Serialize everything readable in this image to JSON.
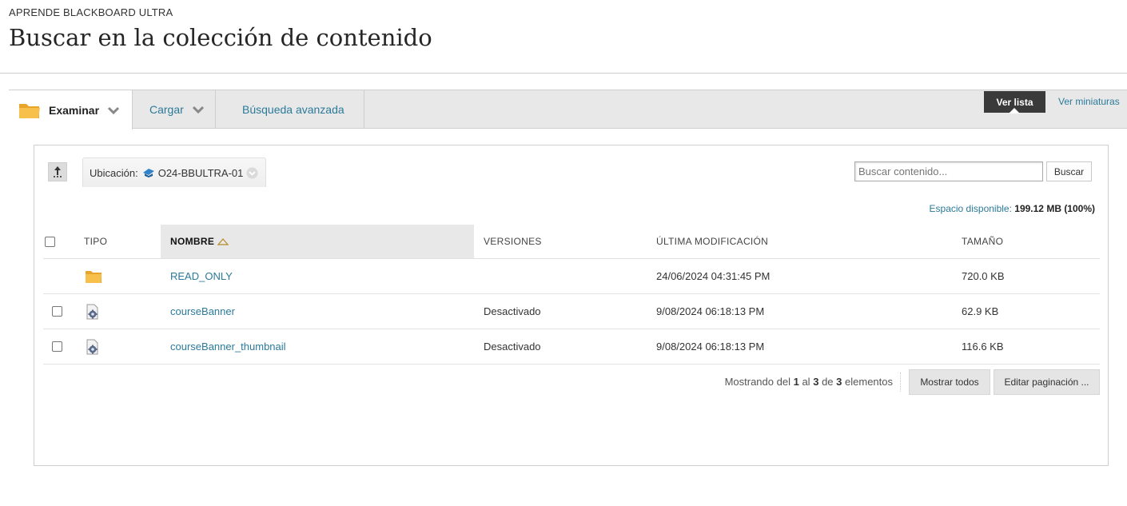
{
  "header": {
    "breadcrumb": "APRENDE BLACKBOARD ULTRA",
    "title": "Buscar en la colección de contenido"
  },
  "tabs": {
    "examinar": "Examinar",
    "cargar": "Cargar",
    "busqueda": "Búsqueda avanzada"
  },
  "view": {
    "list_label": "Ver lista",
    "thumbnails_label": "Ver miniaturas"
  },
  "location": {
    "label": "Ubicación:",
    "value": "O24-BBULTRA-01"
  },
  "search": {
    "placeholder": "Buscar contenido...",
    "button_label": "Buscar"
  },
  "space": {
    "label": "Espacio disponible:",
    "value": "199.12 MB (100%)"
  },
  "table": {
    "columns": {
      "tipo": "TIPO",
      "nombre": "NOMBRE",
      "versiones": "VERSIONES",
      "modificacion": "ÚLTIMA MODIFICACIÓN",
      "tamano": "TAMAÑO"
    },
    "rows": [
      {
        "name": "READ_ONLY",
        "type": "folder",
        "versions": "",
        "modified": "24/06/2024 04:31:45 PM",
        "size": "720.0 KB"
      },
      {
        "name": "courseBanner",
        "type": "file",
        "versions": "Desactivado",
        "modified": "9/08/2024 06:18:13 PM",
        "size": "62.9 KB"
      },
      {
        "name": "courseBanner_thumbnail",
        "type": "file",
        "versions": "Desactivado",
        "modified": "9/08/2024 06:18:13 PM",
        "size": "116.6 KB"
      }
    ]
  },
  "pager": {
    "prefix": "Mostrando del",
    "from": "1",
    "to_word": "al",
    "to": "3",
    "of_word": "de",
    "total": "3",
    "suffix": "elementos",
    "show_all": "Mostrar todos",
    "edit_paging": "Editar paginación ..."
  },
  "colors": {
    "link": "#2b7a9a",
    "folder": "#f5b83d",
    "dark_button": "#3a3a3a"
  }
}
